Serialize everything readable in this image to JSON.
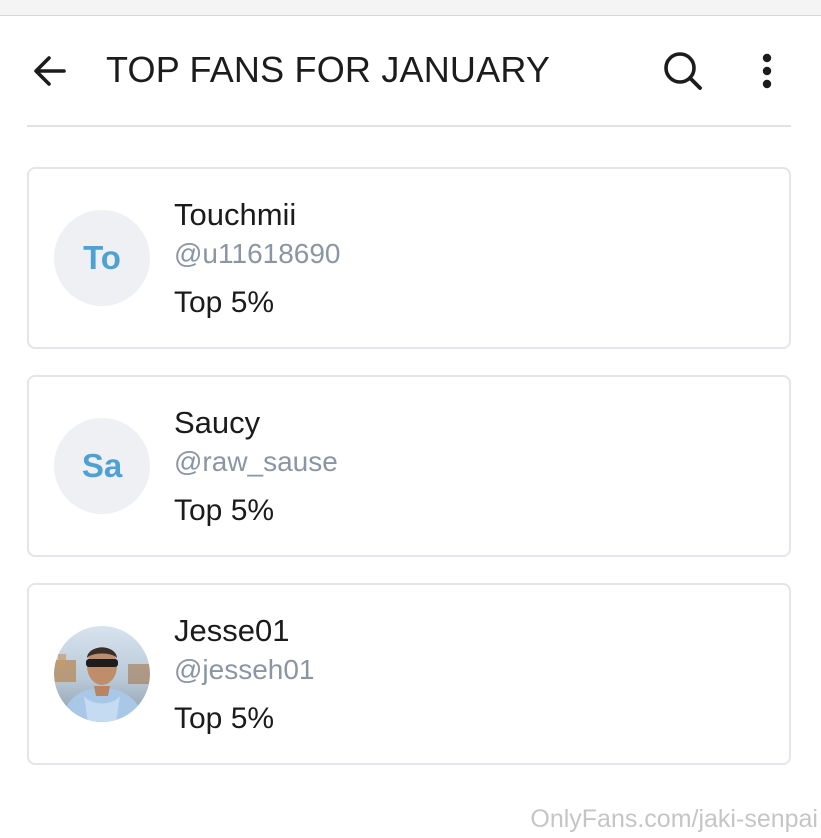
{
  "header": {
    "title": "TOP FANS FOR JANUARY",
    "back_icon": "arrow-left-icon",
    "search_icon": "search-icon",
    "more_icon": "more-vertical-icon"
  },
  "fans": [
    {
      "display_name": "Touchmii",
      "username": "@u11618690",
      "rank": "Top 5%",
      "initials": "To",
      "avatar_type": "initials"
    },
    {
      "display_name": "Saucy",
      "username": "@raw_sause",
      "rank": "Top 5%",
      "initials": "Sa",
      "avatar_type": "initials"
    },
    {
      "display_name": "Jesse01",
      "username": "@jesseh01",
      "rank": "Top 5%",
      "initials": "",
      "avatar_type": "photo"
    }
  ],
  "watermark": "OnlyFans.com/jaki-senpai",
  "colors": {
    "initials": "#4ea1d3",
    "username": "#8a96a3",
    "avatar_bg": "#eef0f3",
    "card_border": "#e3e5e8"
  }
}
